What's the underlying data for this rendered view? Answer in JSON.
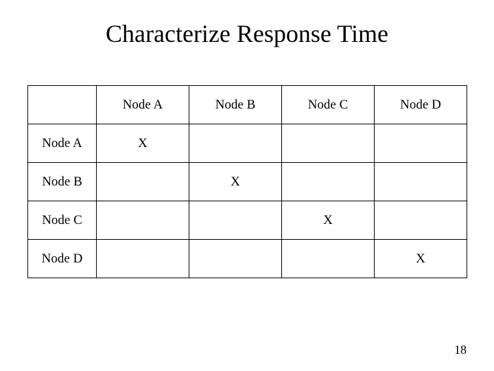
{
  "title": "Characterize Response Time",
  "page_number": "18",
  "table": {
    "col_headers": [
      "Node A",
      "Node B",
      "Node C",
      "Node D"
    ],
    "row_headers": [
      "Node A",
      "Node B",
      "Node C",
      "Node D"
    ],
    "rows": [
      [
        "X",
        "",
        "",
        ""
      ],
      [
        "",
        "X",
        "",
        ""
      ],
      [
        "",
        "",
        "X",
        ""
      ],
      [
        "",
        "",
        "",
        "X"
      ]
    ]
  },
  "chart_data": {
    "type": "table",
    "title": "Characterize Response Time",
    "columns": [
      "Node A",
      "Node B",
      "Node C",
      "Node D"
    ],
    "rows": [
      "Node A",
      "Node B",
      "Node C",
      "Node D"
    ],
    "cells": [
      [
        "X",
        "",
        "",
        ""
      ],
      [
        "",
        "X",
        "",
        ""
      ],
      [
        "",
        "",
        "X",
        ""
      ],
      [
        "",
        "",
        "",
        "X"
      ]
    ]
  }
}
